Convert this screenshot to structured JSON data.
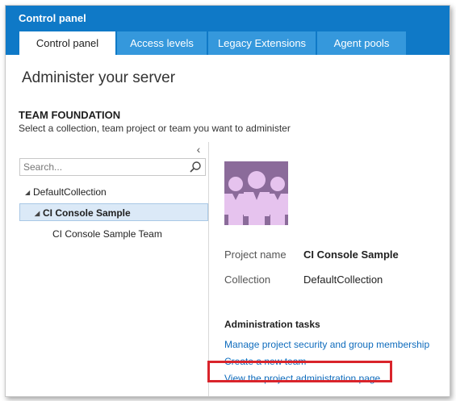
{
  "app": {
    "title": "Control panel"
  },
  "tabs": [
    {
      "label": "Control panel"
    },
    {
      "label": "Access levels"
    },
    {
      "label": "Legacy Extensions"
    },
    {
      "label": "Agent pools"
    }
  ],
  "page": {
    "title": "Administer your server",
    "section_title": "TEAM FOUNDATION",
    "section_desc": "Select a collection, team project or team you want to administer"
  },
  "search": {
    "placeholder": "Search..."
  },
  "tree": [
    {
      "label": "DefaultCollection",
      "expanded": true
    },
    {
      "label": "CI Console Sample",
      "expanded": true,
      "selected": true
    },
    {
      "label": "CI Console Sample Team"
    }
  ],
  "project": {
    "name_label": "Project name",
    "name_value": "CI Console Sample",
    "collection_label": "Collection",
    "collection_value": "DefaultCollection",
    "avatar_color": "#8b6b9a"
  },
  "tasks": {
    "title": "Administration tasks",
    "links": [
      "Manage project security and group membership",
      "Create a new team",
      "View the project administration page"
    ]
  },
  "colors": {
    "header": "#0f79c7",
    "tab_inactive": "#3598dc",
    "link": "#0f6cbd",
    "highlight": "#d9242b"
  },
  "icons": {
    "search": "search-icon",
    "collapse": "chevron-left-icon",
    "team": "team-icon"
  }
}
